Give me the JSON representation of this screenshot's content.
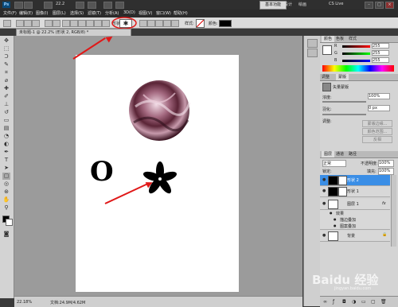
{
  "appbar": {
    "app_badge": "Ps",
    "zoom": "22.2",
    "workspace_current": "基本功能",
    "workspace_other1": "设计",
    "workspace_other2": "绘画",
    "cs_live": "CS Live",
    "min": "–",
    "max": "□",
    "close": "×"
  },
  "menu": [
    "文件(F)",
    "编辑(E)",
    "图像(I)",
    "图层(L)",
    "选择(S)",
    "滤镜(T)",
    "分析(A)",
    "3D(D)",
    "视图(V)",
    "窗口(W)",
    "帮助(H)"
  ],
  "options": {
    "shape_label": "形状:",
    "style_label": "样式:",
    "color_label": "颜色:"
  },
  "document_tab": "未标题-1 @ 22.2% (形状 2, RGB/8) *",
  "status": {
    "zoom": "22.18%",
    "doc": "文档:24.9M/4.62M"
  },
  "canvas_shapes": {
    "letter": "O"
  },
  "color_panel": {
    "tab_color": "颜色",
    "tab_swatch": "色板",
    "tab_style": "样式",
    "r": "R",
    "g": "G",
    "b": "B",
    "r_val": "255",
    "g_val": "255",
    "b_val": "255"
  },
  "adjust_panel": {
    "tab_adjust": "调整",
    "tab_mask": "蒙版",
    "title": "矢量蒙版",
    "density_label": "浓度:",
    "density_value": "100%",
    "feather_label": "羽化:",
    "feather_value": "0 px",
    "refine": "调整:",
    "btn_edge": "蒙版边缘...",
    "btn_range": "颜色范围...",
    "btn_invert": "反相"
  },
  "layers_panel": {
    "tab_layers": "图层",
    "tab_channels": "通道",
    "tab_paths": "路径",
    "blend_mode": "正常",
    "opacity_label": "不透明度:",
    "opacity_value": "100%",
    "lock_label": "锁定:",
    "fill_label": "填充:",
    "fill_value": "100%",
    "layers": [
      {
        "name": "形状 2",
        "selected": true
      },
      {
        "name": "形状 1",
        "selected": false
      },
      {
        "name": "图层 1",
        "selected": false,
        "fx": "fx"
      },
      {
        "name": "效果",
        "sub": true
      },
      {
        "name": "描边叠加",
        "sub": true
      },
      {
        "name": "图案叠加",
        "sub": true
      },
      {
        "name": "背景",
        "selected": false
      }
    ]
  },
  "watermark": {
    "text": "Baidu 经验",
    "sub": "jingyan.baidu.com"
  },
  "colors": {
    "accent_blue": "#3a8ee6",
    "annotation_red": "#e01818"
  }
}
